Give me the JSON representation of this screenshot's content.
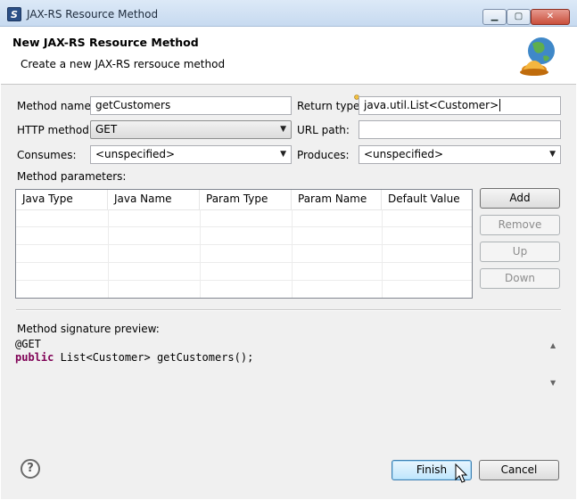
{
  "window": {
    "title": "JAX-RS Resource Method",
    "icon": "eclipse-s-icon",
    "buttons": {
      "minimize": "minimize-icon",
      "maximize": "maximize-icon",
      "close": "close-icon"
    }
  },
  "header": {
    "title": "New JAX-RS Resource Method",
    "subtitle": "Create a new JAX-RS rersouce method",
    "icon": "globe-bell-icon"
  },
  "form": {
    "method_name": {
      "label": "Method name:",
      "value": "getCustomers"
    },
    "return_type": {
      "label": "Return type:",
      "value": "java.util.List<Customer>"
    },
    "http_method": {
      "label": "HTTP method:",
      "value": "GET"
    },
    "url_path": {
      "label": "URL path:",
      "value": ""
    },
    "consumes": {
      "label": "Consumes:",
      "value": "<unspecified>"
    },
    "produces": {
      "label": "Produces:",
      "value": "<unspecified>"
    }
  },
  "params": {
    "label": "Method parameters:",
    "columns": [
      "Java Type",
      "Java Name",
      "Param Type",
      "Param Name",
      "Default Value"
    ],
    "rows": []
  },
  "buttons": {
    "add": "Add",
    "remove": "Remove",
    "up": "Up",
    "down": "Down",
    "finish": "Finish",
    "cancel": "Cancel"
  },
  "preview": {
    "label": "Method signature preview:",
    "line1": "@GET",
    "line2_keyword": "public",
    "line2_rest": " List<Customer> getCustomers();"
  },
  "colors": {
    "keyword": "#7f0055",
    "dialog_bg": "#f0f0f0",
    "default_button_border": "#3c7fb1"
  }
}
